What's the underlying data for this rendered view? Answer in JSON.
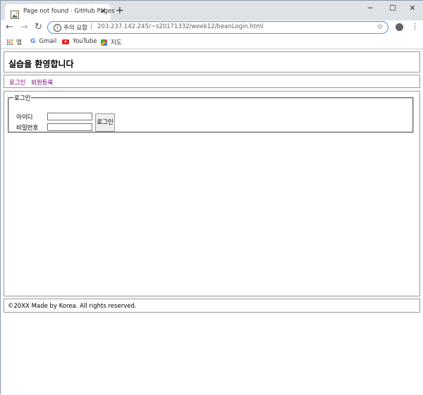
{
  "browser": {
    "tab_title": "Page not found · GitHub Pages",
    "tab_close": "✕",
    "new_tab": "+",
    "window": {
      "minimize": "─",
      "maximize": "☐",
      "close": "✕"
    },
    "nav": {
      "back": "←",
      "forward": "→",
      "reload": "↻"
    },
    "security_warning": "주의 요함",
    "url": "203.237.142.245/~s20171332/week12/beanLogin.html",
    "bookmarks": [
      {
        "label": "앱",
        "icon": "apps-grid-icon"
      },
      {
        "label": "Gmail",
        "icon": "google-icon"
      },
      {
        "label": "YouTube",
        "icon": "youtube-icon"
      },
      {
        "label": "지도",
        "icon": "maps-icon"
      }
    ]
  },
  "page": {
    "header_title": "실습을 환영합니다",
    "nav_links": [
      "로그인",
      "회원등록"
    ],
    "login_form": {
      "legend": "로그인",
      "id_label": "아이디",
      "password_label": "비밀번호",
      "id_value": "",
      "password_value": "",
      "submit_label": "로그인"
    },
    "footer_text": "©20XX Made by Korea. All rights reserved."
  },
  "colors": {
    "link": "#800080",
    "tabstrip": "#dee1e6",
    "omnibox_border": "#4d90fe"
  }
}
